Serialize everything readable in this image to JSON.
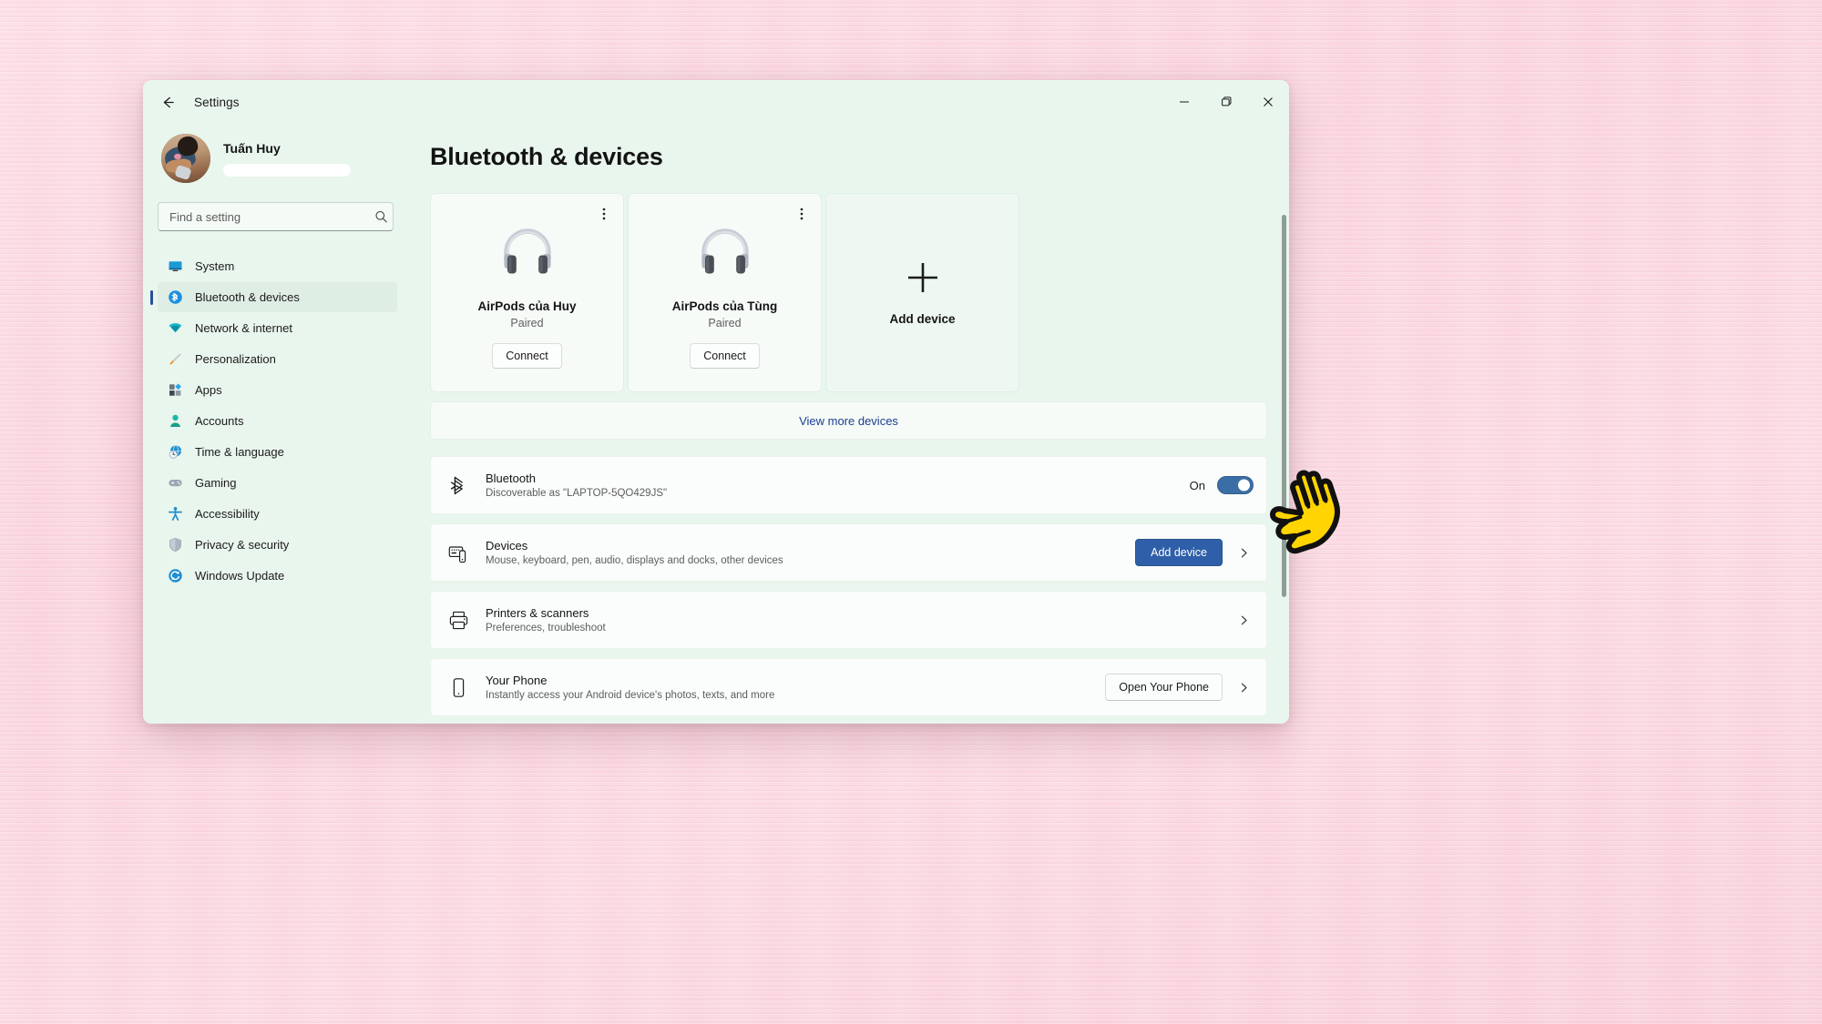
{
  "window": {
    "app_title": "Settings",
    "back_icon": "back-arrow-icon",
    "minimize_label": "─",
    "maximize_label": "❐",
    "close_label": "✕"
  },
  "sidebar": {
    "profile": {
      "name": "Tuấn Huy",
      "avatar": "user-avatar-photo",
      "redacted_field": ""
    },
    "search": {
      "placeholder": "Find a setting",
      "value": "",
      "icon": "search-icon"
    },
    "items": [
      {
        "label": "System",
        "icon": "monitor-icon",
        "selected": false
      },
      {
        "label": "Bluetooth & devices",
        "icon": "bluetooth-icon",
        "selected": true
      },
      {
        "label": "Network & internet",
        "icon": "wifi-icon",
        "selected": false
      },
      {
        "label": "Personalization",
        "icon": "paintbrush-icon",
        "selected": false
      },
      {
        "label": "Apps",
        "icon": "apps-grid-icon",
        "selected": false
      },
      {
        "label": "Accounts",
        "icon": "person-icon",
        "selected": false
      },
      {
        "label": "Time & language",
        "icon": "clock-globe-icon",
        "selected": false
      },
      {
        "label": "Gaming",
        "icon": "gamepad-icon",
        "selected": false
      },
      {
        "label": "Accessibility",
        "icon": "accessibility-person-icon",
        "selected": false
      },
      {
        "label": "Privacy & security",
        "icon": "shield-icon",
        "selected": false
      },
      {
        "label": "Windows Update",
        "icon": "update-refresh-icon",
        "selected": false
      }
    ]
  },
  "main": {
    "page_title": "Bluetooth & devices",
    "device_cards": [
      {
        "name": "AirPods của Huy",
        "status": "Paired",
        "action_label": "Connect",
        "icon": "headphones-icon",
        "menu_icon": "more-options-icon"
      },
      {
        "name": "AirPods của Tùng",
        "status": "Paired",
        "action_label": "Connect",
        "icon": "headphones-icon",
        "menu_icon": "more-options-icon"
      }
    ],
    "add_device_card": {
      "label": "Add device",
      "icon": "plus-icon"
    },
    "view_more_devices": "View more devices",
    "bluetooth_row": {
      "icon": "bluetooth-icon",
      "title": "Bluetooth",
      "subtitle": "Discoverable as \"LAPTOP-5QO429JS\"",
      "toggle_state_label": "On",
      "toggle_on": true
    },
    "rows": [
      {
        "icon": "devices-icon",
        "title": "Devices",
        "subtitle": "Mouse, keyboard, pen, audio, displays and docks, other devices",
        "button": "Add device",
        "button_style": "accent",
        "chevron": "chevron-right-icon"
      },
      {
        "icon": "printer-icon",
        "title": "Printers & scanners",
        "subtitle": "Preferences, troubleshoot",
        "button": "",
        "button_style": "none",
        "chevron": "chevron-right-icon"
      },
      {
        "icon": "phone-icon",
        "title": "Your Phone",
        "subtitle": "Instantly access your Android device's photos, texts, and more",
        "button": "Open Your Phone",
        "button_style": "light",
        "chevron": "chevron-right-icon"
      }
    ]
  },
  "colors": {
    "accent_blue": "#2f5fa8",
    "toggle_blue": "#3b6ea5",
    "link_blue": "#1b3f8f",
    "selection_indicator": "#2a4f96",
    "window_bg": "#e9f6ed",
    "card_bg": "#f6fbf8",
    "wallpaper": "#fbd9e0",
    "cursor_yellow": "#ffd200"
  },
  "cursor": {
    "icon": "pointing-hand-cursor"
  }
}
